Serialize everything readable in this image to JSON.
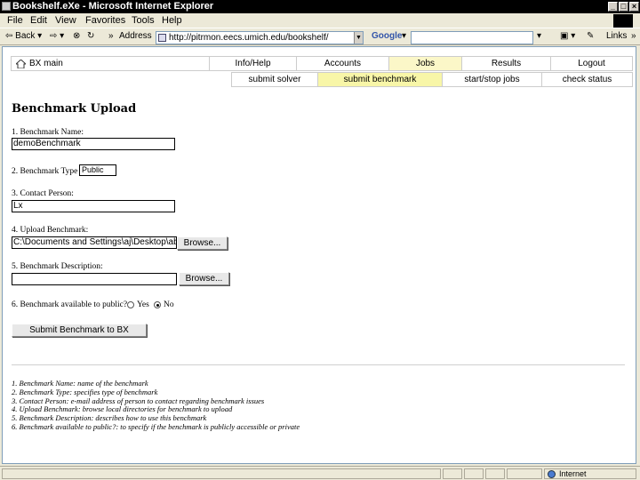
{
  "window": {
    "title": "Bookshelf.eXe - Microsoft Internet Explorer"
  },
  "menu": [
    "File",
    "Edit",
    "View",
    "Favorites",
    "Tools",
    "Help"
  ],
  "toolbar": {
    "back": "Back",
    "address_label": "Address",
    "address_value": "http://pitrmon.eecs.umich.edu/bookshelf/",
    "google": "Google",
    "links": "Links"
  },
  "nav": {
    "top": [
      {
        "label": "BX  main"
      },
      {
        "label": "Info/Help"
      },
      {
        "label": "Accounts"
      },
      {
        "label": "Jobs"
      },
      {
        "label": "Results"
      },
      {
        "label": "Logout"
      }
    ],
    "sub": [
      {
        "label": "submit solver"
      },
      {
        "label": "submit benchmark"
      },
      {
        "label": "start/stop jobs"
      },
      {
        "label": "check status"
      }
    ]
  },
  "page": {
    "title": "Benchmark Upload",
    "f1_label": "1. Benchmark Name:",
    "f1_value": "demoBenchmark",
    "f2_label": "2. Benchmark Type",
    "f2_value": "Public",
    "f3_label": "3. Contact Person:",
    "f3_value": "Lx",
    "f4_label": "4. Upload Benchmark:",
    "f4_value": "C:\\Documents and Settings\\aj\\Desktop\\abm",
    "f5_label": "5. Benchmark Description:",
    "f5_value": "",
    "browse": "Browse...",
    "f6_label": "6. Benchmark available to public?",
    "yes": "Yes",
    "no": "No",
    "submit": "Submit Benchmark to BX"
  },
  "notes": [
    "1. Benchmark Name: name of the benchmark",
    "2. Benchmark Type: specifies type of benchmark",
    "3. Contact Person: e-mail address of person to contact regarding benchmark issues",
    "4. Upload Benchmark: browse local directories for benchmark to upload",
    "5. Benchmark Description: describes how to use this benchmark",
    "6. Benchmark available to public?: to specify if the benchmark is publicly accessible or private"
  ],
  "status": {
    "zone": "Internet"
  }
}
